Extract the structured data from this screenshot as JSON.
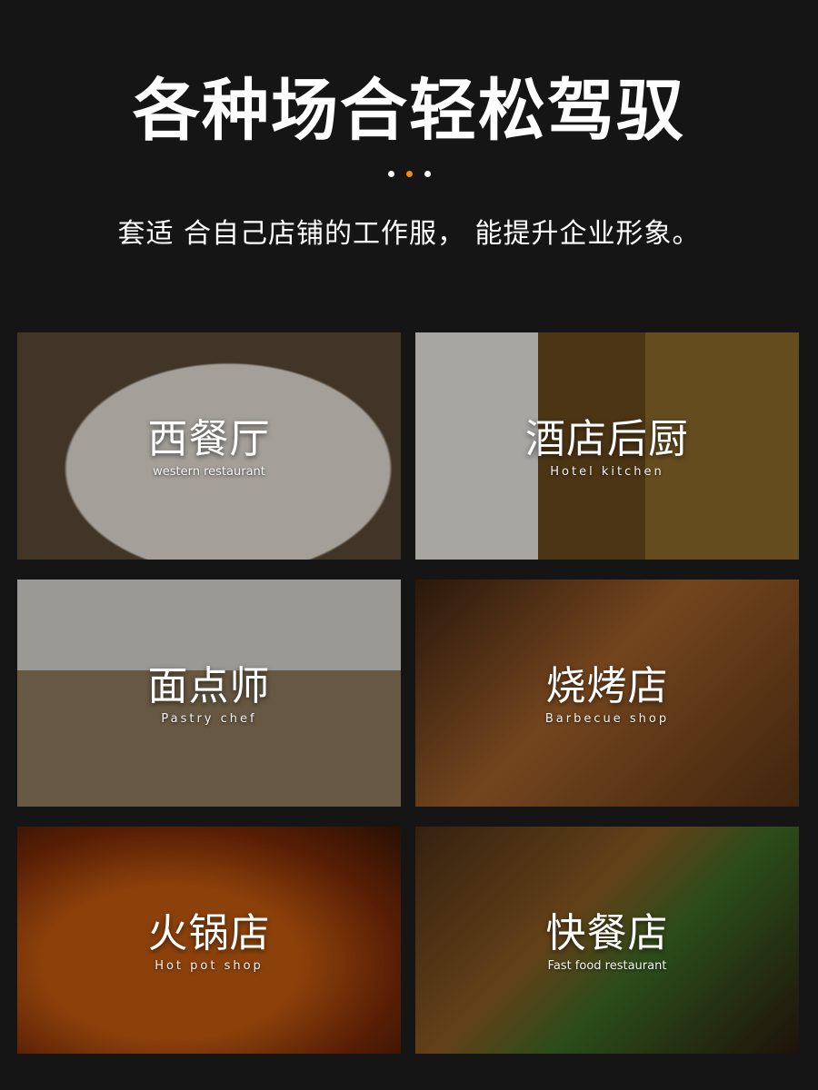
{
  "header": {
    "title": "各种场合轻松驾驭",
    "subtitle": "套适 合自己店铺的工作服， 能提升企业形象。"
  },
  "colors": {
    "background": "#151515",
    "dot_inactive": "#ffffff",
    "dot_active": "#f08a1c"
  },
  "cards": [
    {
      "title": "西餐厅",
      "subtitle": "western restaurant"
    },
    {
      "title": "酒店后厨",
      "subtitle": "Hotel kitchen"
    },
    {
      "title": "面点师",
      "subtitle": "Pastry chef"
    },
    {
      "title": "烧烤店",
      "subtitle": "Barbecue shop"
    },
    {
      "title": "火锅店",
      "subtitle": "Hot pot shop"
    },
    {
      "title": "快餐店",
      "subtitle": "Fast food restaurant"
    }
  ]
}
